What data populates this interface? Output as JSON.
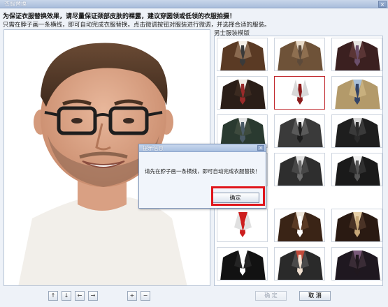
{
  "window": {
    "title": "衣服替换",
    "close_label": "×"
  },
  "hints": {
    "line1": "为保证衣服替换效果，请尽量保证颈部皮肤的裸露，建议穿圆领或低领的衣服拍摄！",
    "line2": "只需在脖子画一条横线，即可自动完成衣服替换。点击微调按钮对服装进行微调，并选择合适的服装。"
  },
  "catalog": {
    "label": "男士服装模版",
    "selected_index": 4
  },
  "tiles": [
    {
      "name": "suit-brown-dark"
    },
    {
      "name": "suit-brown-tan"
    },
    {
      "name": "suit-maroon"
    },
    {
      "name": "suit-black-red-tie"
    },
    {
      "name": "shirt-white-red-collar"
    },
    {
      "name": "suit-tan-blue-shirt"
    },
    {
      "name": "suit-dark-green"
    },
    {
      "name": "suit-gray-pattern"
    },
    {
      "name": "suit-black-gray"
    },
    {
      "name": "suit-black-white"
    },
    {
      "name": "suit-dark-plaid"
    },
    {
      "name": "suit-black-stripe"
    },
    {
      "name": "womens-red-collar"
    },
    {
      "name": "womens-brown-jacket"
    },
    {
      "name": "womens-tan-scarf"
    },
    {
      "name": "womens-black-white"
    },
    {
      "name": "womens-floral-scarf"
    },
    {
      "name": "womens-dark-blouse"
    }
  ],
  "controls": {
    "move_up": "↑",
    "move_down": "↓",
    "move_left": "←",
    "move_right": "→",
    "zoom_in": "+",
    "zoom_out": "−",
    "confirm": "确 定",
    "cancel": "取 消"
  },
  "dialog": {
    "title": "提示信息",
    "message": "请先在脖子画一条横线，即可自动完成衣服替换！",
    "ok": "确定",
    "close_label": "×"
  },
  "colors": {
    "accent_highlight": "#e0151b",
    "title_bar": "#a9bddb"
  }
}
